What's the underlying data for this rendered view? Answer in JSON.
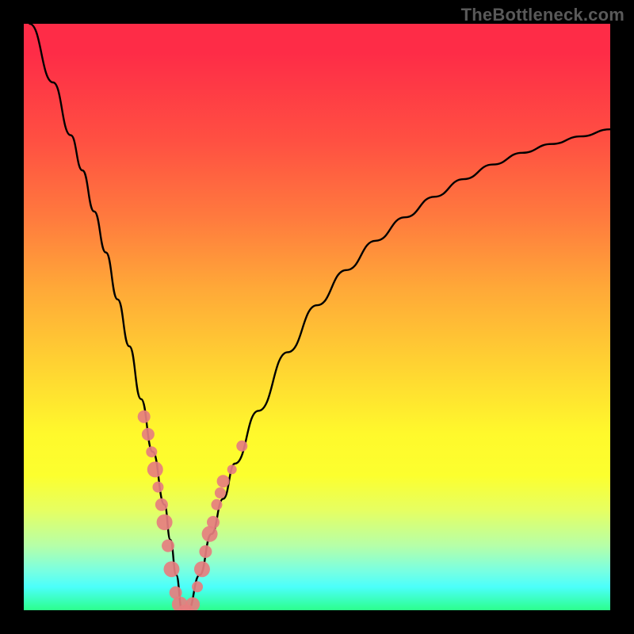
{
  "watermark": "TheBottleneck.com",
  "chart_data": {
    "type": "line",
    "title": "",
    "xlabel": "",
    "ylabel": "",
    "xlim": [
      0,
      100
    ],
    "ylim": [
      0,
      100
    ],
    "series": [
      {
        "name": "bottleneck-curve",
        "x": [
          1,
          5,
          8,
          10,
          12,
          14,
          16,
          18,
          20,
          22,
          24,
          25,
          26,
          27,
          28,
          30,
          32,
          34,
          36,
          40,
          45,
          50,
          55,
          60,
          65,
          70,
          75,
          80,
          85,
          90,
          95,
          100
        ],
        "values": [
          100,
          90,
          81,
          75,
          68,
          61,
          53,
          45,
          36,
          27,
          18,
          12,
          6,
          0,
          0,
          6,
          13,
          19,
          25,
          34,
          44,
          52,
          58,
          63,
          67,
          70.5,
          73.5,
          76,
          78,
          79.5,
          80.8,
          82
        ]
      }
    ],
    "markers": {
      "name": "sample-points",
      "x": [
        20.5,
        21.2,
        21.8,
        22.4,
        22.9,
        23.5,
        24.0,
        24.6,
        25.2,
        25.9,
        26.6,
        27.3,
        28.0,
        28.8,
        29.6,
        30.4,
        31.0,
        31.7,
        32.3,
        32.9,
        33.5,
        34.0,
        35.5,
        37.2
      ],
      "values": [
        33,
        30,
        27,
        24,
        21,
        18,
        15,
        11,
        7,
        3,
        1,
        0,
        0,
        1,
        4,
        7,
        10,
        13,
        15,
        18,
        20,
        22,
        24,
        28
      ],
      "size": [
        8,
        8,
        7,
        10,
        7,
        8,
        10,
        8,
        10,
        8,
        10,
        7,
        7,
        9,
        7,
        10,
        8,
        10,
        8,
        7,
        7,
        8,
        6,
        7
      ]
    },
    "background_gradient": {
      "top": "#fe2c47",
      "mid": "#fff92c",
      "bottom": "#2cff8c"
    }
  }
}
